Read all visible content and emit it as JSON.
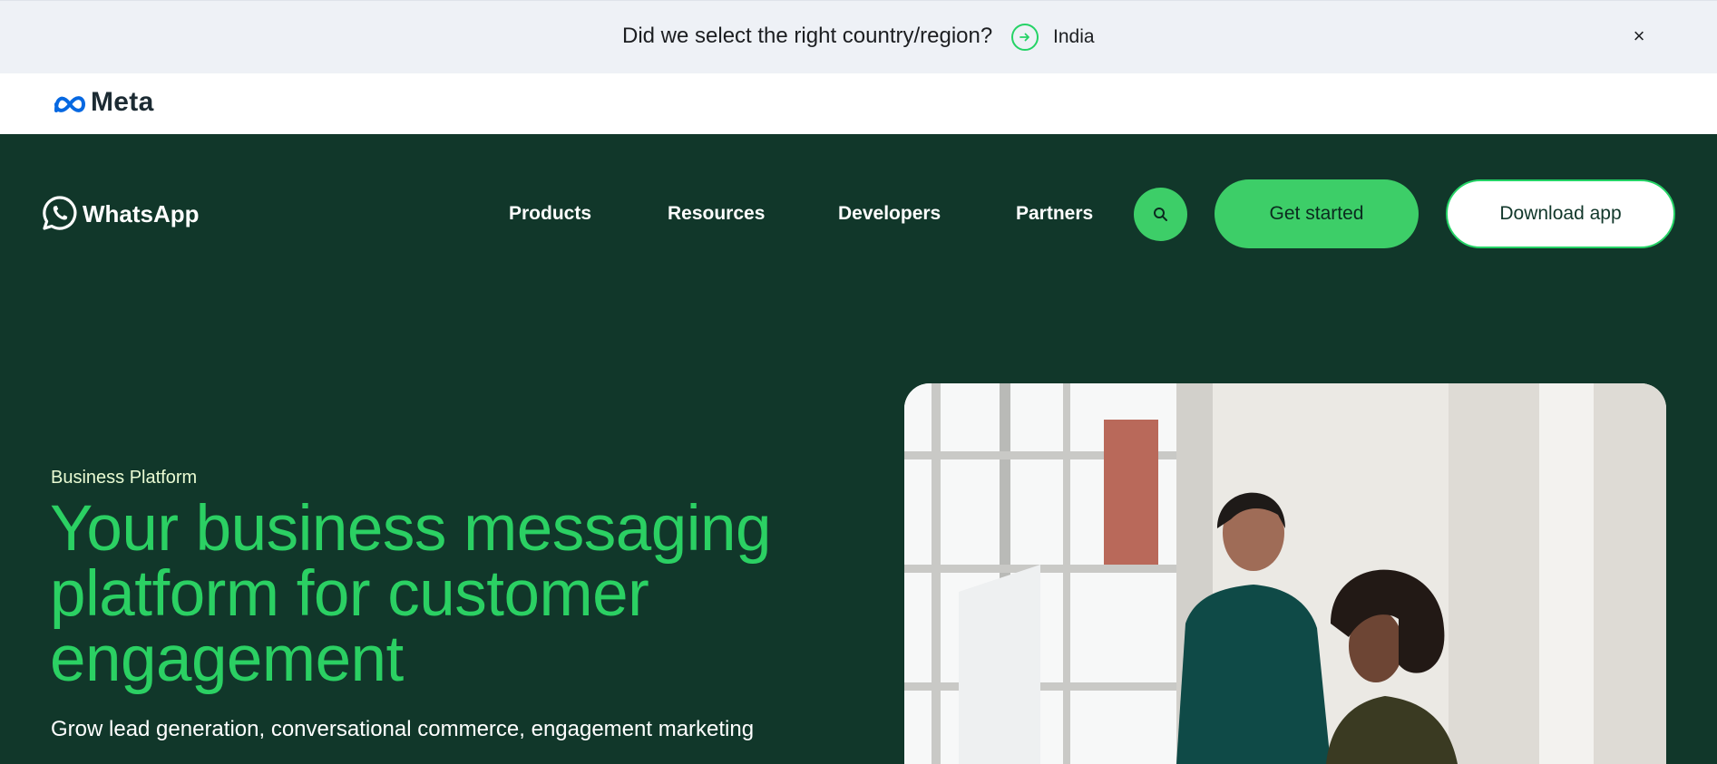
{
  "banner": {
    "question": "Did we select the right country/region?",
    "region": "India",
    "close_label": "×"
  },
  "meta": {
    "brand": "Meta"
  },
  "nav": {
    "brand": "WhatsApp",
    "links": [
      "Products",
      "Resources",
      "Developers",
      "Partners"
    ],
    "get_started": "Get started",
    "download_app": "Download app"
  },
  "hero": {
    "eyebrow": "Business Platform",
    "title": "Your business messaging platform for customer engagement",
    "subtitle": "Grow lead generation, conversational commerce, engagement marketing"
  },
  "colors": {
    "brand_dark": "#11372a",
    "brand_green": "#25d366",
    "title_green": "#2bd063"
  }
}
